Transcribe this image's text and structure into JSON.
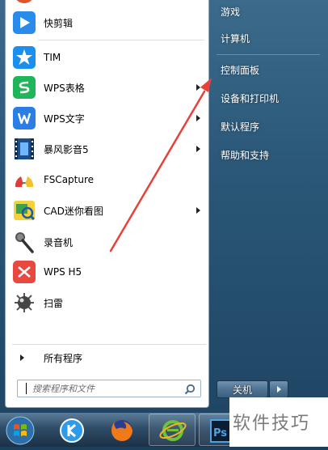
{
  "programs": [
    {
      "label": "快剪辑",
      "icon": "kuaijianji-icon",
      "submenu": false
    },
    {
      "label": "TIM",
      "icon": "tim-icon",
      "submenu": false
    },
    {
      "label": "WPS表格",
      "icon": "wps-spreadsheet-icon",
      "submenu": true
    },
    {
      "label": "WPS文字",
      "icon": "wps-writer-icon",
      "submenu": true
    },
    {
      "label": "暴风影音5",
      "icon": "baofeng-player-icon",
      "submenu": true
    },
    {
      "label": "FSCapture",
      "icon": "fscapture-icon",
      "submenu": false
    },
    {
      "label": "CAD迷你看图",
      "icon": "cad-viewer-icon",
      "submenu": true
    },
    {
      "label": "录音机",
      "icon": "microphone-icon",
      "submenu": false
    },
    {
      "label": "WPS H5",
      "icon": "wps-h5-icon",
      "submenu": false
    },
    {
      "label": "扫雷",
      "icon": "minesweeper-icon",
      "submenu": false
    }
  ],
  "all_programs_label": "所有程序",
  "search": {
    "placeholder": "搜索程序和文件"
  },
  "right_links": [
    "游戏",
    "计算机",
    "控制面板",
    "设备和打印机",
    "默认程序",
    "帮助和支持"
  ],
  "shutdown_label": "关机",
  "taskbar": [
    "start-orb-icon",
    "kuaibo-icon",
    "firefox-icon",
    "ie-icon",
    "photoshop-icon"
  ],
  "watermark": "软件技巧",
  "colors": {
    "arrow": "#e8413a",
    "pane_bg": "#ffffff",
    "right_bg": "#2b5878"
  }
}
